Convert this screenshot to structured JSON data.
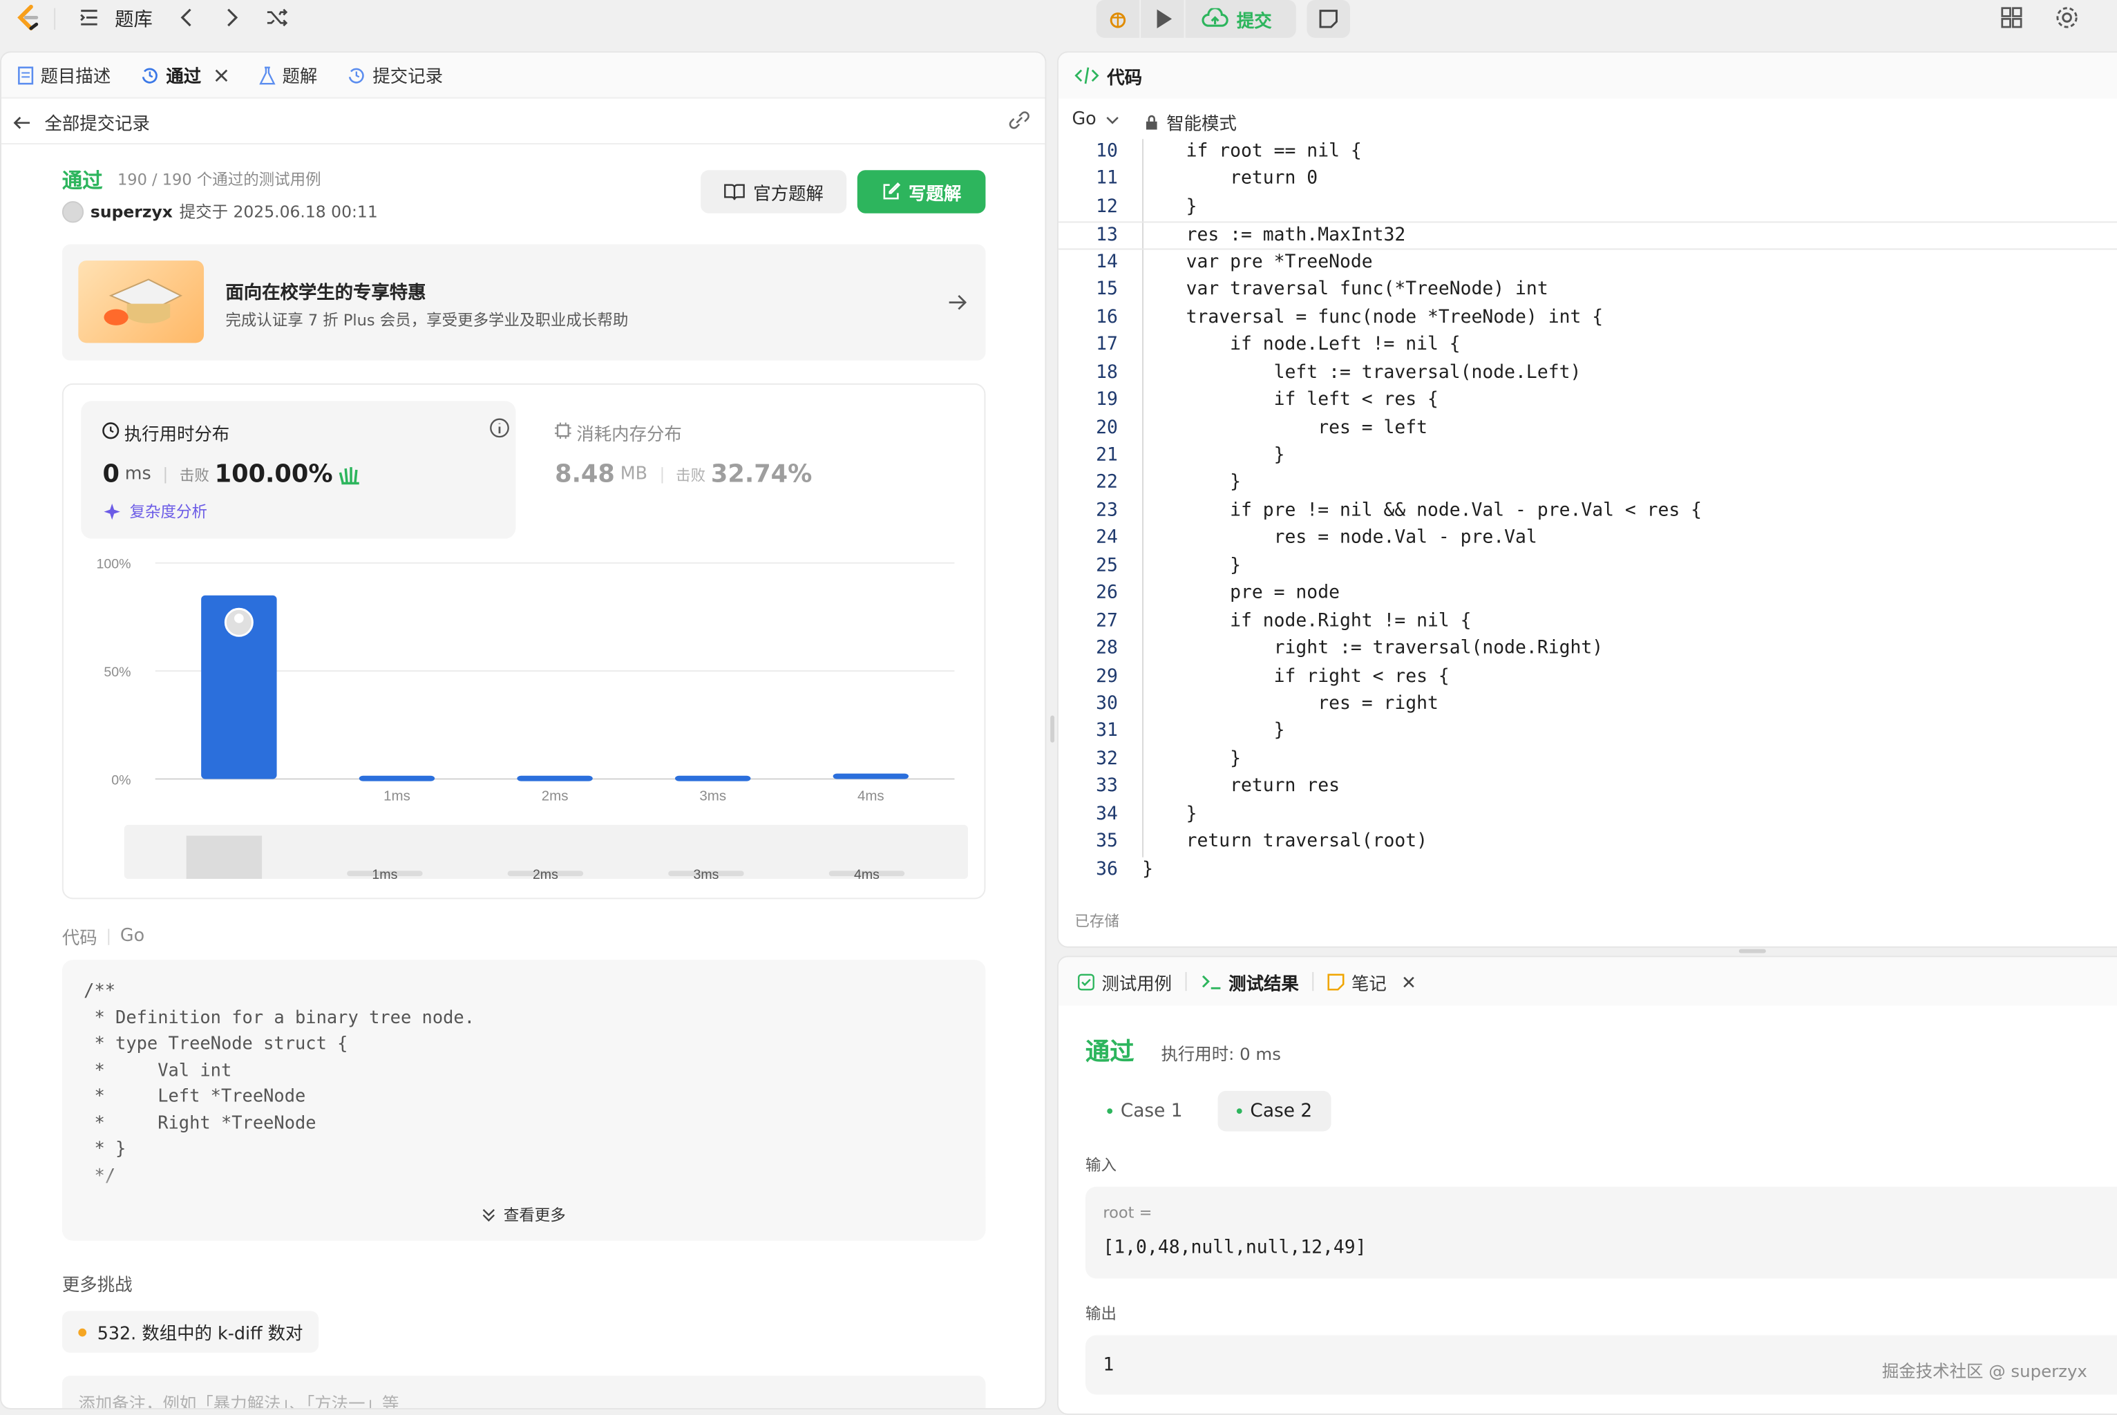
{
  "toolbar": {
    "problem_bank": "题库",
    "submit": "提交"
  },
  "left_tabs": [
    {
      "label": "题目描述"
    },
    {
      "label": "通过"
    },
    {
      "label": "题解"
    },
    {
      "label": "提交记录"
    }
  ],
  "all_submissions": "全部提交记录",
  "result": {
    "status": "通过",
    "cases": "190 / 190 个通过的测试用例",
    "user": "superzyx",
    "submitted_at": "提交于 2025.06.18 00:11",
    "official_solution": "官方题解",
    "write_solution": "写题解"
  },
  "promo": {
    "title": "面向在校学生的专享特惠",
    "subtitle": "完成认证享 7 折 Plus 会员，享受更多学业及职业成长帮助"
  },
  "runtime": {
    "title": "执行用时分布",
    "value": "0",
    "unit": "ms",
    "beat_label": "击败",
    "beat": "100.00%",
    "analysis": "复杂度分析"
  },
  "memory": {
    "title": "消耗内存分布",
    "value": "8.48",
    "unit": "MB",
    "beat_label": "击败",
    "beat": "32.74%"
  },
  "chart_data": {
    "type": "bar",
    "categories": [
      "",
      "1ms",
      "2ms",
      "3ms",
      "4ms"
    ],
    "values": [
      85,
      1.5,
      1.5,
      1.5,
      2.5
    ],
    "yticks": [
      "100%",
      "50%",
      "0%"
    ],
    "ylim": [
      0,
      100
    ],
    "highlight_color": "#2b6fdc",
    "overview_labels": [
      "1ms",
      "2ms",
      "3ms",
      "4ms"
    ]
  },
  "code_section": {
    "label": "代码",
    "lang": "Go",
    "more": "查看更多",
    "lines": [
      "/**",
      " * Definition for a binary tree node.",
      " * type TreeNode struct {",
      " *     Val int",
      " *     Left *TreeNode",
      " *     Right *TreeNode",
      " * }",
      " */"
    ]
  },
  "more_challenges": {
    "label": "更多挑战",
    "item": "532. 数组中的 k-diff 数对"
  },
  "note_placeholder": "添加备注，例如「暴力解法」、「方法一」等",
  "editor": {
    "title": "代码",
    "lang": "Go",
    "mode": "智能模式",
    "saved": "已存储",
    "start_line": 10,
    "current_line": 13
  },
  "code_lines": [
    "    if root == nil {",
    "        return 0",
    "    }",
    "    res := math.MaxInt32",
    "    var pre *TreeNode",
    "    var traversal func(*TreeNode) int",
    "    traversal = func(node *TreeNode) int {",
    "        if node.Left != nil {",
    "            left := traversal(node.Left)",
    "            if left < res {",
    "                res = left",
    "            }",
    "        }",
    "        if pre != nil && node.Val - pre.Val < res {",
    "            res = node.Val - pre.Val",
    "        }",
    "        pre = node",
    "        if node.Right != nil {",
    "            right := traversal(node.Right)",
    "            if right < res {",
    "                res = right",
    "            }",
    "        }",
    "        return res",
    "    }",
    "    return traversal(root)",
    "}"
  ],
  "bottom_tabs": [
    {
      "label": "测试用例"
    },
    {
      "label": "测试结果"
    },
    {
      "label": "笔记"
    }
  ],
  "test": {
    "status": "通过",
    "runtime": "执行用时: 0 ms",
    "case1": "Case 1",
    "case2": "Case 2",
    "input_label": "输入",
    "var": "root =",
    "input": "[1,0,48,null,null,12,49]",
    "output_label": "输出",
    "output": "1"
  },
  "watermark": "掘金技术社区 @ superzyx"
}
